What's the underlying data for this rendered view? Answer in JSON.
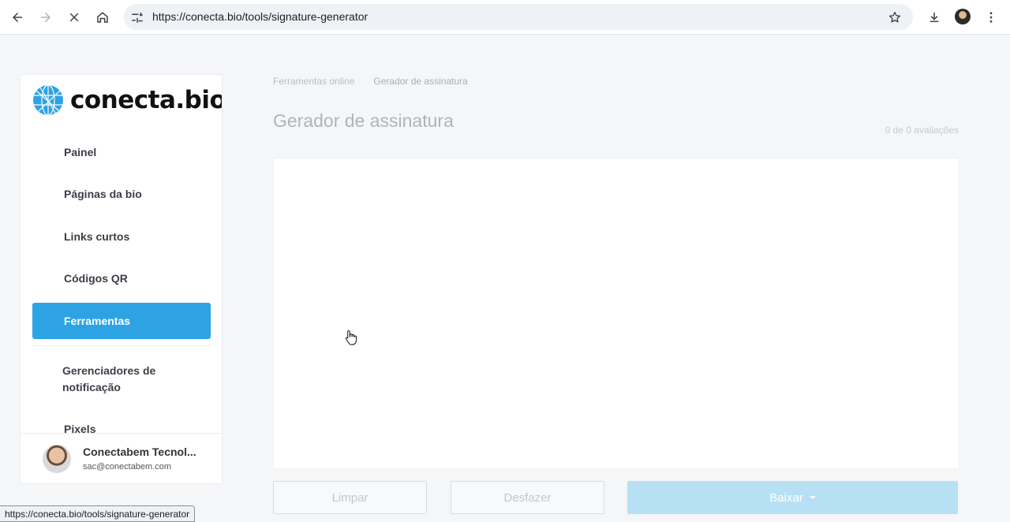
{
  "browser": {
    "url": "https://conecta.bio/tools/signature-generator",
    "status_url": "https://conecta.bio/tools/signature-generator"
  },
  "sidebar": {
    "brand": "conecta.bio",
    "items": [
      {
        "label": "Painel"
      },
      {
        "label": "Páginas da bio"
      },
      {
        "label": "Links curtos"
      },
      {
        "label": "Códigos QR"
      },
      {
        "label": "Ferramentas",
        "active": true
      },
      {
        "label": "Gerenciadores de notificação"
      },
      {
        "label": "Pixels"
      }
    ],
    "user": {
      "name": "Conectabem Tecnol...",
      "email": "sac@conectabem.com"
    }
  },
  "main": {
    "breadcrumb": [
      "Ferramentas online",
      "Gerador de assinatura"
    ],
    "title": "Gerador de assinatura",
    "ratings": "0 de 0 avaliações",
    "buttons": {
      "clear": "Limpar",
      "undo": "Desfazer",
      "download": "Baixar"
    }
  },
  "colors": {
    "accent": "#2ea3e3",
    "accent_disabled": "#b8e0f5"
  }
}
